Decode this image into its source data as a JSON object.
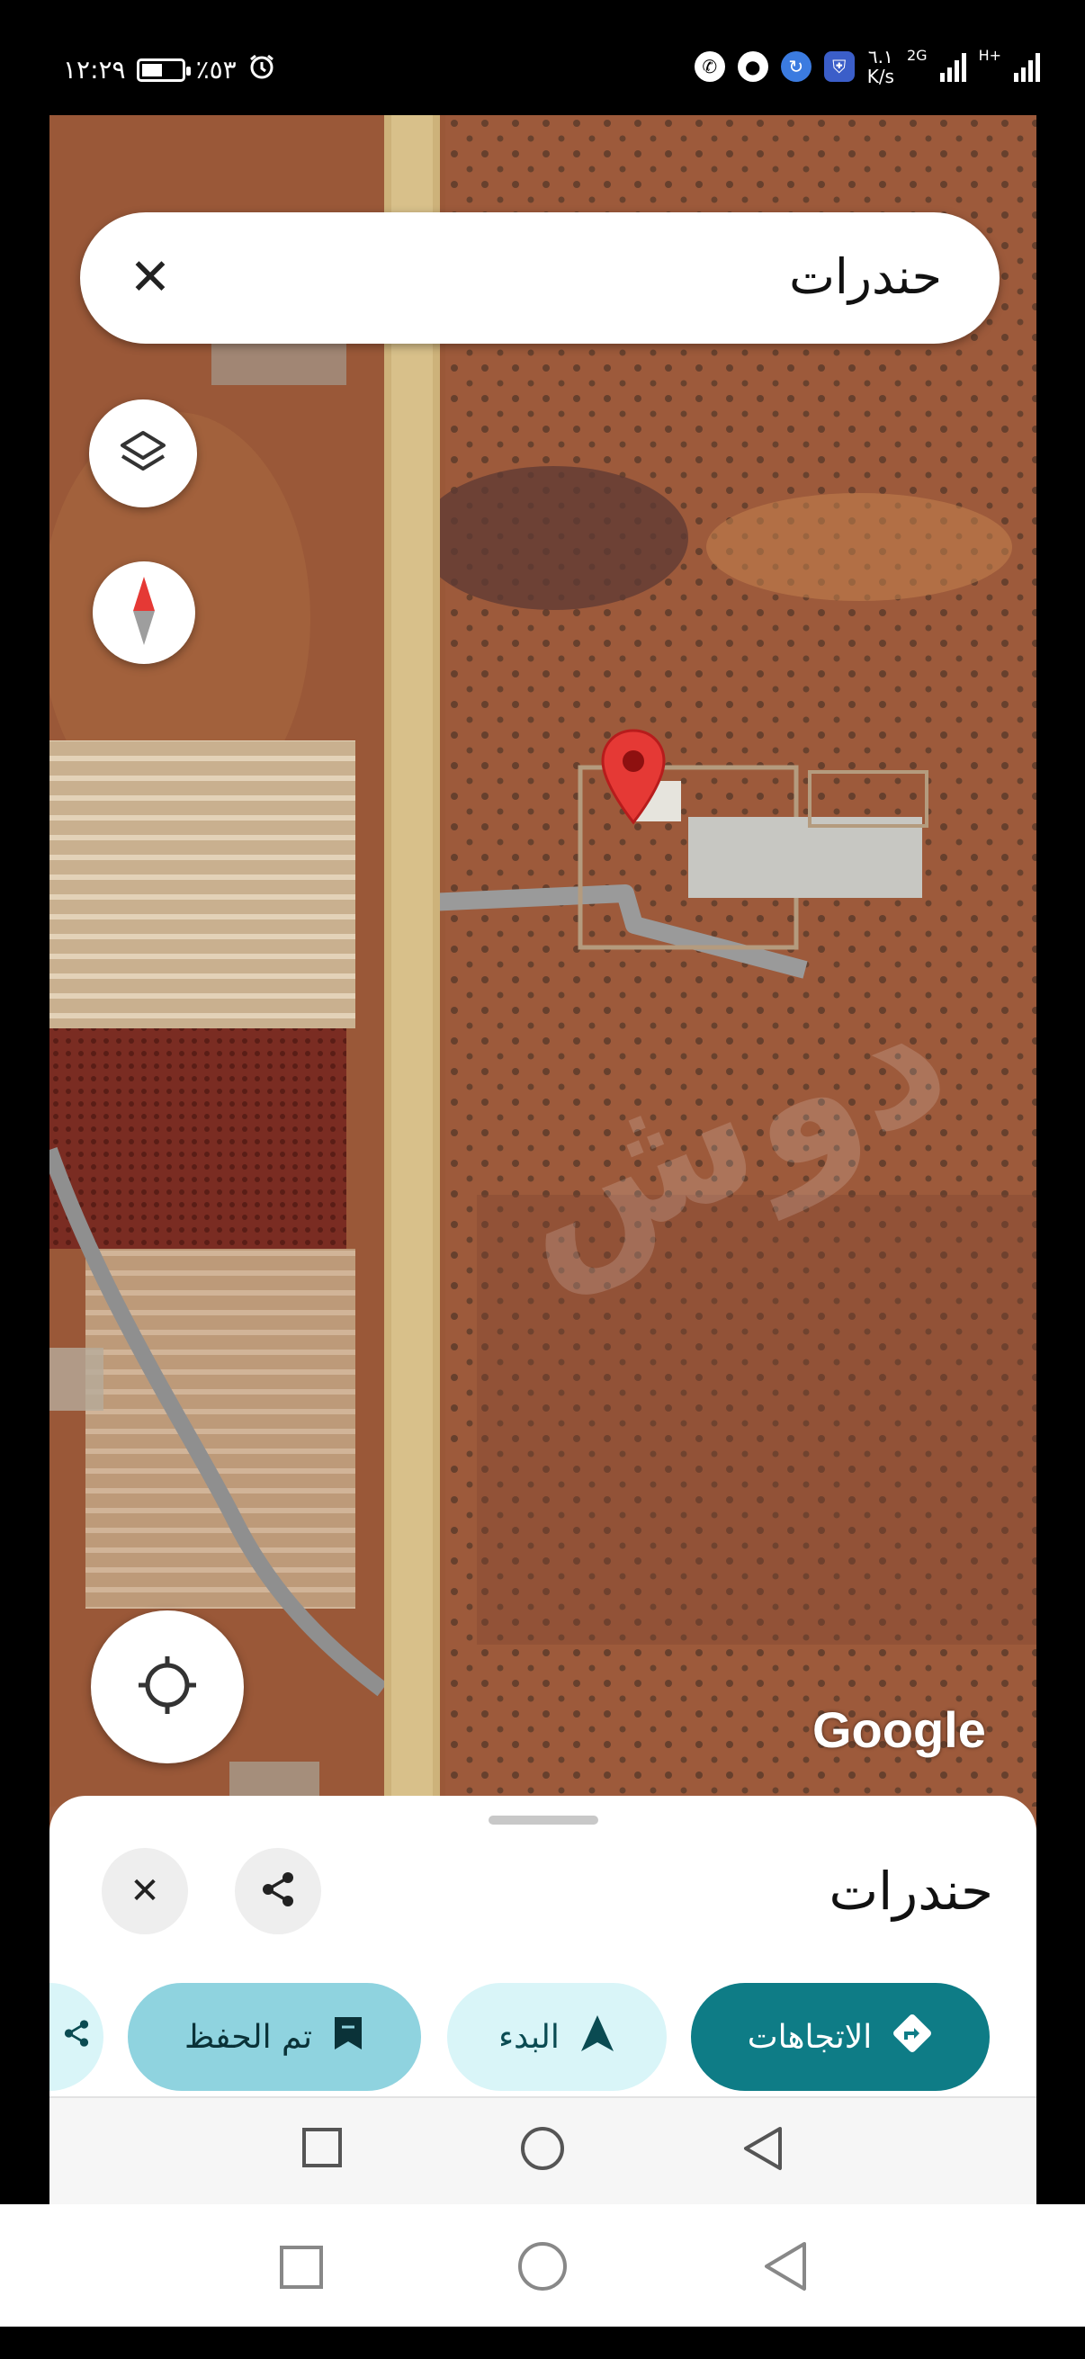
{
  "status_bar": {
    "time": "١٢:٢٩",
    "battery_percent_text": "٪٥٣",
    "battery_level": 0.53,
    "network_speed_value": "٦.١",
    "network_speed_unit": "K/s",
    "network_type_1": "2G",
    "network_type_2": "H+"
  },
  "search": {
    "query": "حندرات"
  },
  "map": {
    "attribution": "Google",
    "watermark": "دوش"
  },
  "place_sheet": {
    "title": "حندرات",
    "buttons": {
      "directions": "الاتجاهات",
      "start": "البدء",
      "saved": "تم الحفظ"
    }
  },
  "icons": {
    "close": "close-icon",
    "layers": "layers-icon",
    "compass": "compass-icon",
    "my_location": "my-location-icon",
    "share": "share-icon",
    "pin": "map-pin-icon",
    "directions": "directions-icon",
    "navigate": "navigation-arrow-icon",
    "bookmark": "bookmark-icon"
  },
  "colors": {
    "directions_chip": "#0e7c86",
    "start_chip": "#d9f5f8",
    "saved_chip": "#8fd3df",
    "pin": "#e53935",
    "compass_red": "#e53935"
  }
}
